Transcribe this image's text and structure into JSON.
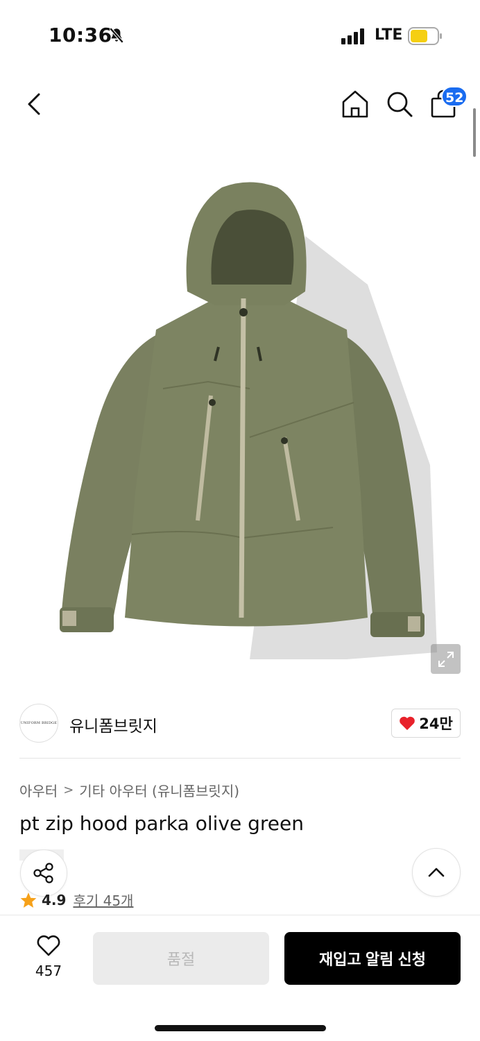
{
  "status_bar": {
    "time": "10:36",
    "network": "LTE",
    "icons": [
      "bell-slash-icon",
      "signal-icon",
      "battery-icon"
    ]
  },
  "header": {
    "back_icon": "chevron-left-icon",
    "home_icon": "home-icon",
    "search_icon": "search-icon",
    "cart_icon": "bag-icon",
    "cart_count": "52"
  },
  "product_image": {
    "alt": "olive green hooded parka",
    "expand_icon": "expand-icon"
  },
  "brand": {
    "logo_text": "UNIFORM BRIDGE",
    "name": "유니폼브릿지",
    "likes": "24만",
    "like_icon": "heart-filled-icon"
  },
  "breadcrumb": {
    "level1": "아우터",
    "separator": ">",
    "level2": "기타 아우터 (유니폼브릿지)"
  },
  "product": {
    "title": "pt zip hood parka olive green"
  },
  "rating": {
    "value": "4.9",
    "reviews": "후기 45개",
    "star_icon": "star-icon"
  },
  "actions": {
    "share_icon": "share-icon",
    "scroll_top_icon": "chevron-up-icon"
  },
  "bottom_bar": {
    "wish_count": "457",
    "soldout_label": "품절",
    "restock_label": "재입고 알림 신청"
  },
  "colors": {
    "accent_blue": "#1a6cf0",
    "heart_red": "#e8222b",
    "star_orange": "#f6a11a",
    "jacket_olive": "#7d8462"
  }
}
